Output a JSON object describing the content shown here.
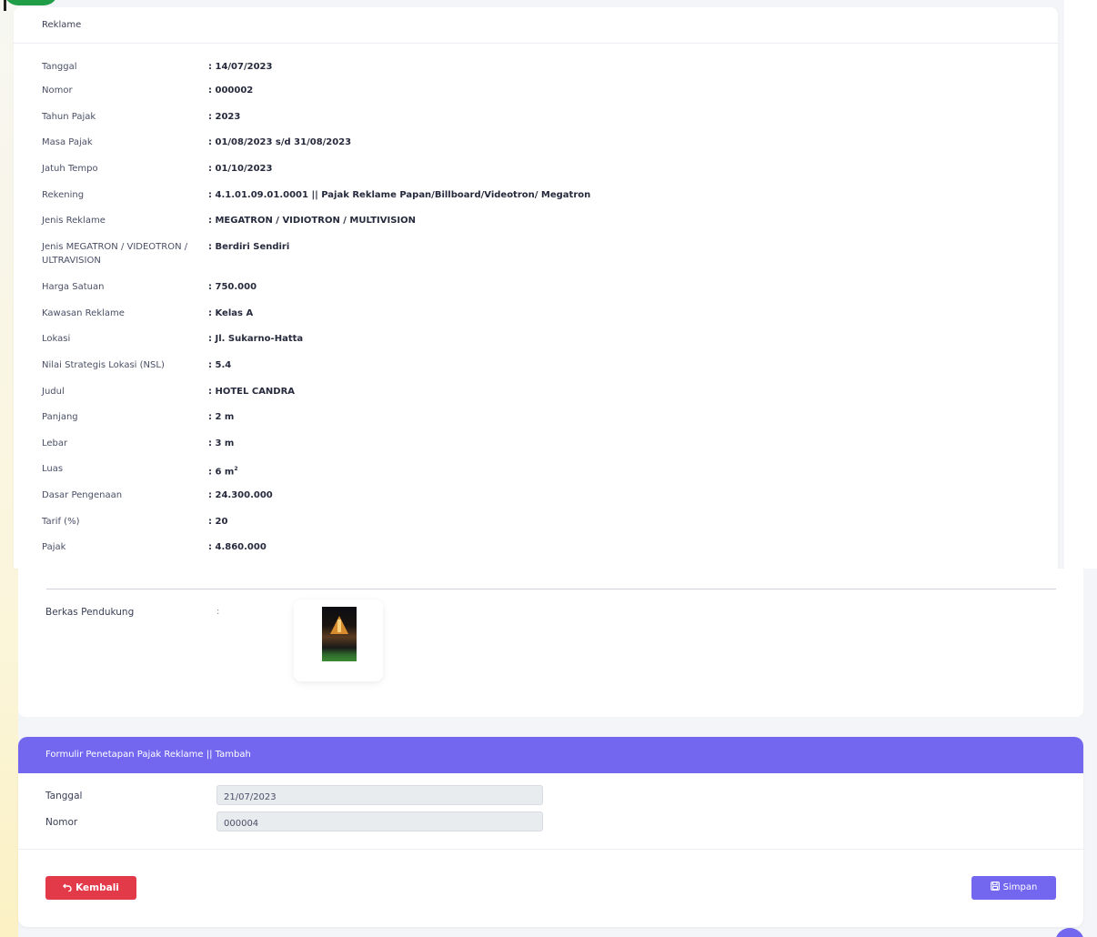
{
  "info_card": {
    "title": "Reklame",
    "rows": [
      {
        "label": "Tanggal",
        "value": ": 14/07/2023"
      },
      {
        "label": "Nomor",
        "value": ": 000002"
      },
      {
        "label": "Tahun Pajak",
        "value": ": 2023"
      },
      {
        "label": "Masa Pajak",
        "value": ": 01/08/2023 s/d 31/08/2023"
      },
      {
        "label": "Jatuh Tempo",
        "value": ": 01/10/2023"
      },
      {
        "label": "Rekening",
        "value": ": 4.1.01.09.01.0001 || Pajak Reklame Papan/Billboard/Videotron/ Megatron"
      },
      {
        "label": "Jenis Reklame",
        "value": ": MEGATRON / VIDIOTRON / MULTIVISION"
      },
      {
        "label": "Jenis MEGATRON / VIDEOTRON / ULTRAVISION",
        "value": ": Berdiri Sendiri"
      },
      {
        "label": "Harga Satuan",
        "value": ": 750.000"
      },
      {
        "label": "Kawasan Reklame",
        "value": ": Kelas A"
      },
      {
        "label": "Lokasi",
        "value": ": Jl. Sukarno-Hatta"
      },
      {
        "label": "Nilai Strategis Lokasi (NSL)",
        "value": ": 5.4"
      },
      {
        "label": "Judul",
        "value": ": HOTEL CANDRA"
      },
      {
        "label": "Panjang",
        "value": ": 2 m"
      },
      {
        "label": "Lebar",
        "value": ": 3 m"
      },
      {
        "label": "Luas",
        "value": ": 6 m",
        "sup": "2"
      },
      {
        "label": "Dasar Pengenaan",
        "value": ": 24.300.000"
      },
      {
        "label": "Tarif (%)",
        "value": ": 20"
      },
      {
        "label": "Pajak",
        "value": ": 4.860.000"
      }
    ]
  },
  "attachments": {
    "label": "Berkas Pendukung",
    "colon": ":"
  },
  "form": {
    "title": "Formulir Penetapan Pajak Reklame || Tambah",
    "tanggal_label": "Tanggal",
    "tanggal_value": "21/07/2023",
    "nomor_label": "Nomor",
    "nomor_value": "000004",
    "back_label": "Kembali",
    "save_label": "Simpan"
  },
  "colors": {
    "primary": "#7367f0",
    "danger": "#e33a4a"
  }
}
